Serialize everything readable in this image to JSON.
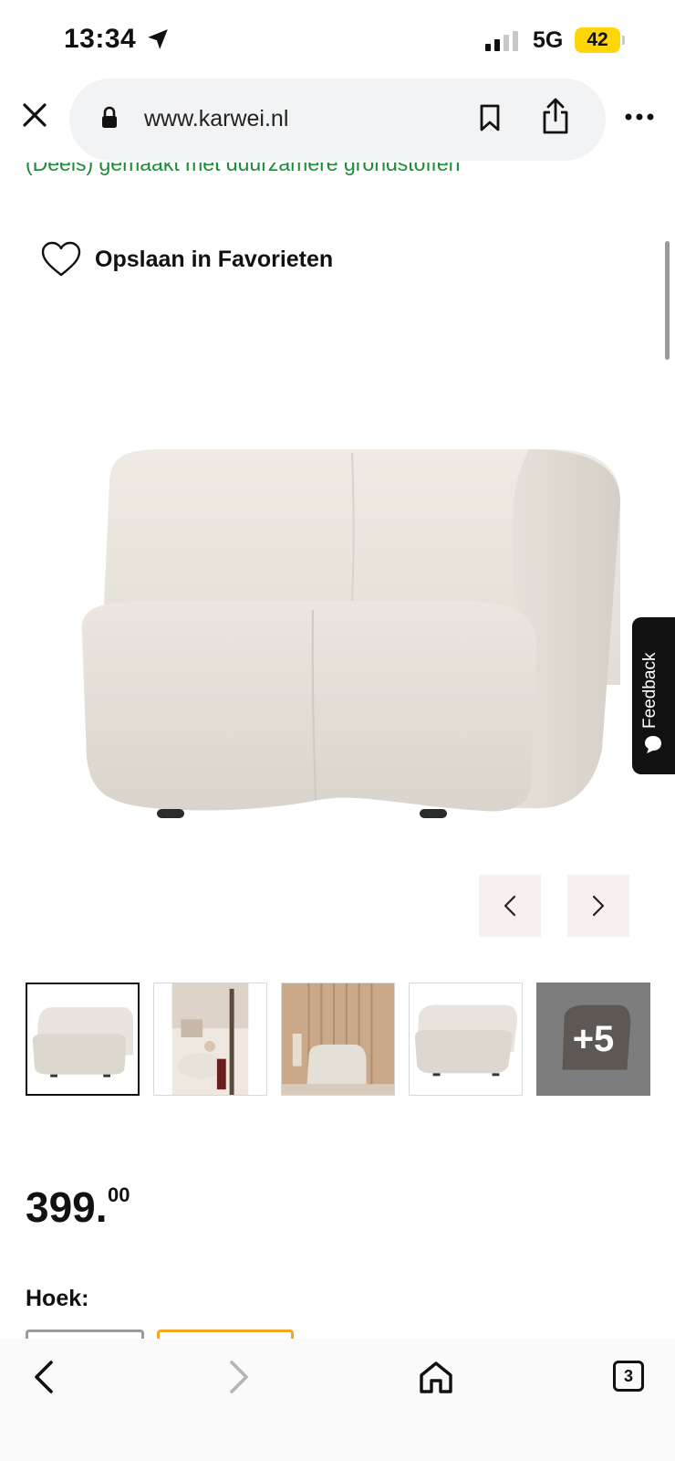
{
  "status_bar": {
    "time": "13:34",
    "network": "5G",
    "battery": "42",
    "icons": [
      "location-arrow-icon",
      "signal-icon",
      "battery-icon"
    ]
  },
  "browser": {
    "url": "www.karwei.nl",
    "icons": [
      "close-icon",
      "lock-icon",
      "bookmark-icon",
      "share-icon",
      "more-icon"
    ]
  },
  "product": {
    "eco_note": "(Deels) gemaakt met duurzamere grondstoffen",
    "favorite_label": "Opslaan in Favorieten",
    "feedback_label": "Feedback",
    "gallery": {
      "more_count": "+5"
    },
    "price_main": "399.",
    "price_cents": "00",
    "option_label": "Hoek:"
  },
  "toolbar": {
    "tabs_count": "3",
    "icons": [
      "back-icon",
      "forward-icon",
      "home-icon",
      "tabs-icon"
    ]
  },
  "colors": {
    "accent_green": "#1f8a3a",
    "battery_yellow": "#ffd60a",
    "selected_option": "#f5a623",
    "arrow_button_bg": "#f6f1ee"
  }
}
